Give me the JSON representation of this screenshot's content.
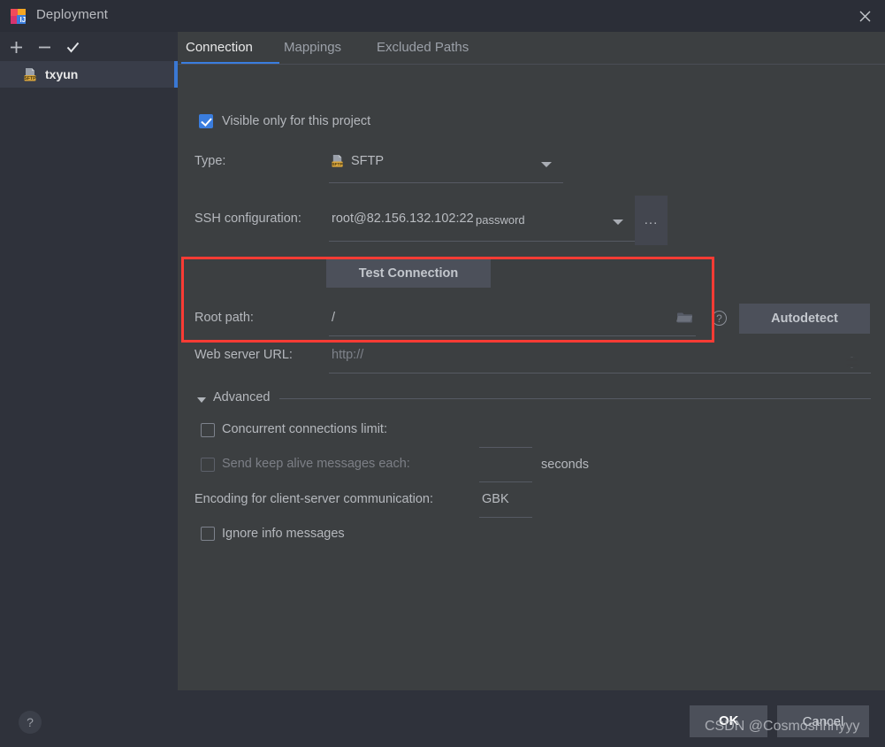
{
  "window": {
    "title": "Deployment",
    "app_icon": "intellij-idea-icon",
    "close_icon": "close-icon"
  },
  "sidebar": {
    "toolbar": [
      {
        "name": "add-button",
        "icon": "plus-icon",
        "label": "+"
      },
      {
        "name": "remove-button",
        "icon": "minus-icon",
        "label": "−"
      },
      {
        "name": "set-default-button",
        "icon": "check-icon",
        "label": "✓"
      }
    ],
    "items": [
      {
        "label": "txyun",
        "icon": "sftp-server-icon",
        "selected": true
      }
    ]
  },
  "tabs": [
    {
      "label": "Connection",
      "active": true
    },
    {
      "label": "Mappings",
      "active": false
    },
    {
      "label": "Excluded Paths",
      "active": false
    }
  ],
  "connection": {
    "visible_only_label": "Visible only for this project",
    "visible_only_checked": true,
    "type_label": "Type:",
    "type_value": "SFTP",
    "type_icon": "sftp-icon",
    "ssh_config_label": "SSH configuration:",
    "ssh_config_value": "root@82.156.132.102:22",
    "ssh_config_auth": "password",
    "ssh_browse_label": "...",
    "test_connection_label": "Test Connection",
    "root_path_label": "Root path:",
    "root_path_value": "/",
    "root_path_browse_icon": "folder-icon",
    "root_path_help_icon": "help-icon",
    "autodetect_label": "Autodetect",
    "web_server_url_label": "Web server URL:",
    "web_server_url_value": "http://",
    "web_server_globe_icon": "globe-icon"
  },
  "advanced": {
    "section_label": "Advanced",
    "expanded": true,
    "concurrent_label": "Concurrent connections limit:",
    "concurrent_checked": false,
    "concurrent_value": "",
    "keepalive_label": "Send keep alive messages each:",
    "keepalive_checked": false,
    "keepalive_value": "",
    "keepalive_unit": "seconds",
    "encoding_label": "Encoding for client-server communication:",
    "encoding_value": "GBK",
    "ignore_info_label": "Ignore info messages",
    "ignore_info_checked": false
  },
  "footer": {
    "help_label": "?",
    "ok_label": "OK",
    "cancel_label": "Cancel",
    "watermark": "CSDN @Cosmoshhhyyy"
  },
  "colors": {
    "accent": "#3a7dde",
    "highlight_box": "#fb3b34",
    "titlebar_bg": "#2b2e37",
    "panel_bg": "#3c3f41",
    "sidebar_bg": "#2f323b"
  }
}
